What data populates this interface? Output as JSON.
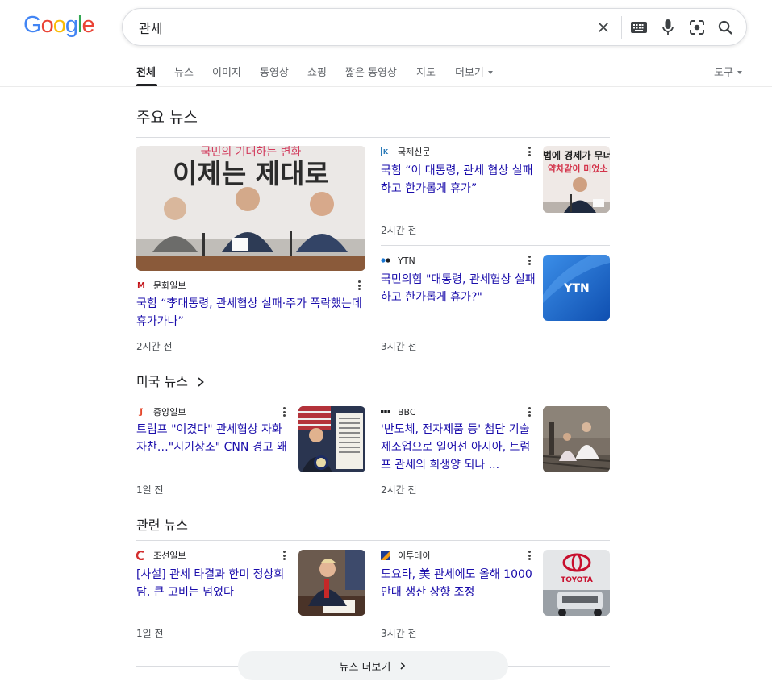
{
  "logo": {
    "letters": [
      "G",
      "o",
      "o",
      "g",
      "l",
      "e"
    ],
    "colors": [
      "#4285f4",
      "#ea4335",
      "#fbbc05",
      "#4285f4",
      "#34a853",
      "#ea4335"
    ]
  },
  "search": {
    "value": "관세",
    "icons": [
      "close-icon",
      "keyboard-icon",
      "mic-icon",
      "lens-icon",
      "search-icon"
    ]
  },
  "tabs": {
    "all": "전체",
    "news": "뉴스",
    "images": "이미지",
    "videos": "동영상",
    "shopping": "쇼핑",
    "shorts": "짧은 동영상",
    "maps": "지도",
    "more": "더보기",
    "tools": "도구"
  },
  "sections": {
    "top": "주요 뉴스",
    "us": "미국 뉴스",
    "related": "관련 뉴스"
  },
  "articles": {
    "a1": {
      "source": "문화일보",
      "title": "국힘 “李대통령, 관세협상 실패·주가 폭락했는데 휴가가나”",
      "time": "2시간 전",
      "thumb_banner": "국민의 기대하는 변화",
      "thumb_text": "이제는 제대로"
    },
    "a2": {
      "source": "국제신문",
      "title": "국힘 “이 대통령, 관세 협상 실패하고 한가롭게 휴가”",
      "time": "2시간 전",
      "thumb_text": "법에 경제가 무너",
      "thumb_text2": "약차같이 미었소"
    },
    "a3": {
      "source": "YTN",
      "title": "국민의힘 \"대통령, 관세협상 실패하고 한가롭게 휴가?\"",
      "time": "3시간 전",
      "thumb_text": "YTN"
    },
    "b1": {
      "source": "중앙일보",
      "title": "트럼프 \"이겼다\" 관세협상 자화자찬…\"시기상조\" CNN 경고 왜",
      "time": "1일 전"
    },
    "b2": {
      "source": "BBC",
      "title": "'반도체, 전자제품 등' 첨단 기술 제조업으로 일어선 아시아, 트럼프 관세의 희생양 되나 ...",
      "time": "2시간 전"
    },
    "c1": {
      "source": "조선일보",
      "title": "[사설] 관세 타결과 한미 정상회담, 큰 고비는 넘었다",
      "time": "1일 전"
    },
    "c2": {
      "source": "이투데이",
      "title": "도요타, 美 관세에도 올해 1000만대 생산 상향 조정",
      "time": "3시간 전",
      "thumb_text": "TOYOTA"
    }
  },
  "more_news": "뉴스 더보기",
  "colors": {
    "link": "#1a0dab",
    "text": "#202124",
    "muted": "#4d5156",
    "divider": "#dadce0"
  }
}
